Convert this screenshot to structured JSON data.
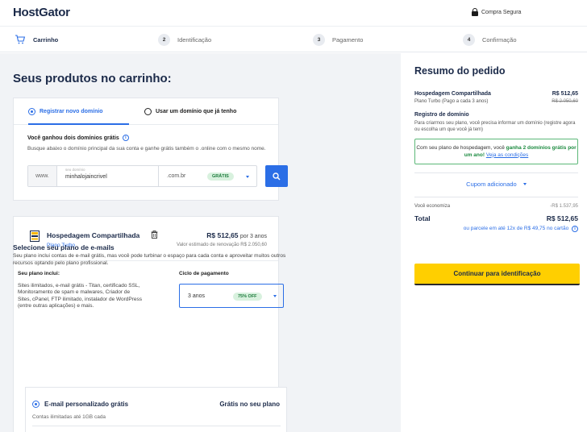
{
  "header": {
    "logo": "HostGator",
    "secure_label": "Compra Segura"
  },
  "stepper": {
    "steps": [
      {
        "num": "",
        "label": "Carrinho"
      },
      {
        "num": "2",
        "label": "Identificação"
      },
      {
        "num": "3",
        "label": "Pagamento"
      },
      {
        "num": "4",
        "label": "Confirmação"
      }
    ]
  },
  "main": {
    "title": "Seus produtos no carrinho:",
    "domain_card": {
      "option_new": "Registrar novo domínio",
      "option_existing": "Usar um domínio que já tenho",
      "gain_title": "Você ganhou dois domínios grátis",
      "gain_desc": "Busque abaixo o domínio principal da sua conta e ganhe grátis também o .online com o mesmo nome.",
      "www": "www.",
      "input_label": "seu domínio",
      "input_value": "minhalojaincrivel",
      "tld": ".com.br",
      "tld_badge": "GRÁTIS"
    },
    "hosting_card": {
      "title": "Hospedagem Compartilhada",
      "plan": "Plano Turbo",
      "price": "R$ 512,65",
      "price_period": "por 3 anos",
      "renewal": "Valor estimado de renovação R$ 2.050,60",
      "includes_title": "Seu plano inclui:",
      "includes_text": "Sites ilimitados, e-mail grátis - Titan, certificado SSL, Monitoramento de spam e malwares, Criador de Sites, cPanel, FTP ilimitado, instalador de WordPress (entre outras aplicações) e mais.",
      "cycle_title": "Ciclo de pagamento",
      "cycle_value": "3 anos",
      "cycle_badge": "75% OFF"
    },
    "email": {
      "title": "Selecione seu plano de e-mails",
      "desc": "Seu plano inclui contas de e-mail grátis, mas você pode turbinar o espaço para cada conta e aproveitar muitos outros recursos optando pelo plano profissional.",
      "option": "E-mail personalizado grátis",
      "option_price": "Grátis no seu plano",
      "option_sub": "Contas ilimitadas até 1GB cada"
    }
  },
  "sidebar": {
    "title": "Resumo do pedido",
    "hosting_name": "Hospedagem Compartilhada",
    "hosting_price": "R$ 512,65",
    "hosting_plan": "Plano Turbo (Pago a cada 3 anos)",
    "hosting_old_price": "R$ 2.050,60",
    "domain_title": "Registro de domínio",
    "domain_desc": "Para criarmos seu plano, você precisa informar um domínio (registre agora ou escolha um que você já tem)",
    "promo_text": "Com seu plano de hospedagem, você ",
    "promo_green": "ganha 2 domínios grátis por um ano!",
    "promo_link": "Veja as condições",
    "coupon": "Cupom adicionado",
    "savings_label": "Você economiza",
    "savings_value": "-R$ 1.537,95",
    "total_label": "Total",
    "total_value": "R$ 512,65",
    "installments": "ou parcele em até 12x de R$ 49,75 no cartão",
    "cta": "Continuar para identificação"
  }
}
